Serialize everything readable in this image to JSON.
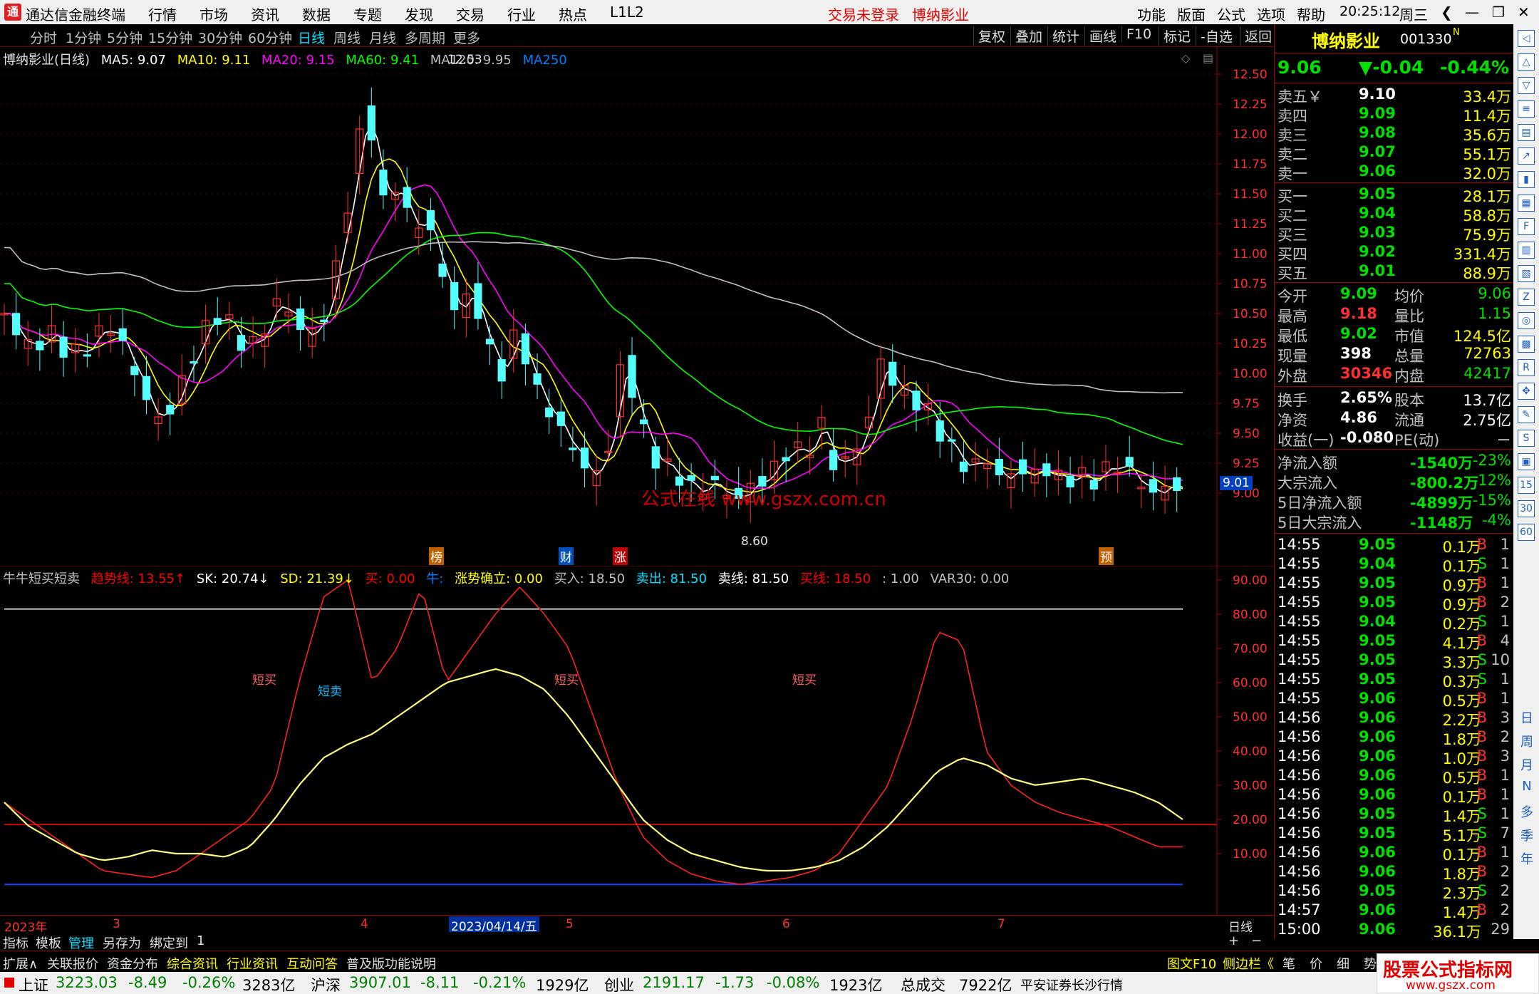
{
  "app": {
    "title": "通达信金融终端",
    "warn1": "交易未登录",
    "stock_title": "博纳影业",
    "l2": "L1L2",
    "menus": [
      "行情",
      "市场",
      "资讯",
      "数据",
      "专题",
      "发现",
      "交易",
      "行业",
      "热点"
    ],
    "right_menus": [
      "功能",
      "版面",
      "公式",
      "选项",
      "帮助"
    ],
    "time": "20:25:12",
    "weekday": "周三"
  },
  "periods": [
    "分时",
    "1分钟",
    "5分钟",
    "15分钟",
    "30分钟",
    "60分钟",
    "日线",
    "周线",
    "月线",
    "多周期",
    "更多"
  ],
  "selected_period": "日线",
  "tools": [
    "复权",
    "叠加",
    "统计",
    "画线",
    "F10",
    "标记",
    "-自选",
    "返回"
  ],
  "main": {
    "name": "博纳影业(日线)",
    "ma": [
      {
        "t": "MA5: 9.07",
        "c": "#ffffff"
      },
      {
        "t": "MA10: 9.11",
        "c": "#ffff00"
      },
      {
        "t": "MA20: 9.15",
        "c": "#ff00ff"
      },
      {
        "t": "MA60: 9.41",
        "c": "#00ff00"
      },
      {
        "t": "MA120: 9.95",
        "c": "#c0c0c0"
      },
      {
        "t": "MA250",
        "c": "#0080ff"
      }
    ],
    "high_label": "12.53",
    "low_label": "8.60",
    "last_label": "9.01",
    "watermark": "公式在线 www.gszx.com.cn",
    "marks": [
      {
        "t": "榜",
        "c": "#ff8000"
      },
      {
        "t": "财",
        "c": "#0080ff"
      },
      {
        "t": "涨",
        "c": "#ff0000"
      },
      {
        "t": "预",
        "c": "#ff8000"
      }
    ],
    "yticks": [
      "12.50",
      "12.25",
      "12.00",
      "11.75",
      "11.50",
      "11.25",
      "11.00",
      "10.75",
      "10.50",
      "10.25",
      "10.00",
      "9.75",
      "9.50",
      "9.25",
      "9.00"
    ]
  },
  "ind": {
    "legend": [
      {
        "t": "牛牛短买短卖",
        "c": "#c0c0c0"
      },
      {
        "t": "趋势线: 13.55↑",
        "c": "#ff0000"
      },
      {
        "t": "SK: 20.74↓",
        "c": "#ffffff"
      },
      {
        "t": "SD: 21.39↓",
        "c": "#ffff00"
      },
      {
        "t": "买: 0.00",
        "c": "#ff0000"
      },
      {
        "t": "牛:",
        "c": "#0080ff"
      },
      {
        "t": "涨势确立: 0.00",
        "c": "#ffff00"
      },
      {
        "t": "买入: 18.50",
        "c": "#c0c0c0"
      },
      {
        "t": "卖出: 81.50",
        "c": "#00e0ff"
      },
      {
        "t": "卖线: 81.50",
        "c": "#ffffff"
      },
      {
        "t": "买线: 18.50",
        "c": "#ff0000"
      },
      {
        "t": ": 1.00",
        "c": "#c0c0c0"
      },
      {
        "t": "VAR30: 0.00",
        "c": "#c0c0c0"
      }
    ],
    "labels": [
      {
        "t": "短买",
        "c": "#ff6060"
      },
      {
        "t": "短卖",
        "c": "#00c0ff"
      },
      {
        "t": "短买",
        "c": "#ff6060"
      },
      {
        "t": "短买",
        "c": "#ff6060"
      }
    ],
    "yticks": [
      "90.00",
      "80.00",
      "70.00",
      "60.00",
      "50.00",
      "40.00",
      "30.00",
      "20.00",
      "10.00"
    ]
  },
  "dates": [
    "2023年",
    "3",
    "4",
    "2023/04/14/五",
    "5",
    "6",
    "7",
    "日线"
  ],
  "tabs": [
    "指标",
    "模板",
    "管理",
    "另存为",
    "绑定到",
    "1"
  ],
  "status_tabs": [
    "扩展∧",
    "关联报价",
    "资金分布",
    "综合资讯",
    "行业资讯",
    "互动问答",
    "普及版功能说明"
  ],
  "status_right": [
    "图文F10",
    "侧边栏《",
    "笔",
    "价",
    "细",
    "势"
  ],
  "quote": {
    "name": "博纳影业",
    "code": "001330",
    "tag": "N",
    "price": "9.06",
    "change": "▼-0.04",
    "pct": "-0.44%",
    "asks": [
      {
        "l": "卖五￥",
        "p": "9.10",
        "v": "33.4万"
      },
      {
        "l": "卖四",
        "p": "9.09",
        "v": "11.4万"
      },
      {
        "l": "卖三",
        "p": "9.08",
        "v": "35.6万"
      },
      {
        "l": "卖二",
        "p": "9.07",
        "v": "55.1万"
      },
      {
        "l": "卖一",
        "p": "9.06",
        "v": "32.0万"
      }
    ],
    "bids": [
      {
        "l": "买一",
        "p": "9.05",
        "v": "28.1万"
      },
      {
        "l": "买二",
        "p": "9.04",
        "v": "58.8万"
      },
      {
        "l": "买三",
        "p": "9.03",
        "v": "75.9万"
      },
      {
        "l": "买四",
        "p": "9.02",
        "v": "331.4万"
      },
      {
        "l": "买五",
        "p": "9.01",
        "v": "88.9万"
      }
    ],
    "stats": [
      [
        "今开",
        "9.09",
        "均价",
        "9.06"
      ],
      [
        "最高",
        "9.18",
        "量比",
        "1.15"
      ],
      [
        "最低",
        "9.02",
        "市值",
        "124.5亿"
      ],
      [
        "现量",
        "398",
        "总量",
        "72763"
      ],
      [
        "外盘",
        "30346",
        "内盘",
        "42417"
      ]
    ],
    "stats2": [
      [
        "换手",
        "2.65%",
        "股本",
        "13.7亿"
      ],
      [
        "净资",
        "4.86",
        "流通",
        "2.75亿"
      ],
      [
        "收益(一)",
        "-0.080",
        "PE(动)",
        "－"
      ]
    ],
    "flows": [
      [
        "净流入额",
        "-1540万",
        "-23%"
      ],
      [
        "大宗流入",
        "-800.2万",
        "-12%"
      ],
      [
        "5日净流入额",
        "-4899万",
        "-15%"
      ],
      [
        "5日大宗流入",
        "-1148万",
        "-4%"
      ]
    ],
    "ticks": [
      [
        "14:55",
        "9.05",
        "0.1万",
        "B",
        "1"
      ],
      [
        "14:55",
        "9.04",
        "0.1万",
        "S",
        "1"
      ],
      [
        "14:55",
        "9.05",
        "0.9万",
        "B",
        "1"
      ],
      [
        "14:55",
        "9.05",
        "0.9万",
        "B",
        "2"
      ],
      [
        "14:55",
        "9.04",
        "0.2万",
        "S",
        "1"
      ],
      [
        "14:55",
        "9.05",
        "4.1万",
        "B",
        "4"
      ],
      [
        "14:55",
        "9.05",
        "3.3万",
        "S",
        "10"
      ],
      [
        "14:55",
        "9.05",
        "0.3万",
        "S",
        "1"
      ],
      [
        "14:55",
        "9.06",
        "0.5万",
        "B",
        "1"
      ],
      [
        "14:56",
        "9.06",
        "2.2万",
        "B",
        "3"
      ],
      [
        "14:56",
        "9.06",
        "1.8万",
        "B",
        "2"
      ],
      [
        "14:56",
        "9.06",
        "1.0万",
        "B",
        "3"
      ],
      [
        "14:56",
        "9.06",
        "0.5万",
        "B",
        "1"
      ],
      [
        "14:56",
        "9.06",
        "0.1万",
        "B",
        "1"
      ],
      [
        "14:56",
        "9.05",
        "1.4万",
        "S",
        "1"
      ],
      [
        "14:56",
        "9.05",
        "5.1万",
        "S",
        "7"
      ],
      [
        "14:56",
        "9.06",
        "0.1万",
        "B",
        "1"
      ],
      [
        "14:56",
        "9.06",
        "1.8万",
        "B",
        "2"
      ],
      [
        "14:56",
        "9.05",
        "2.3万",
        "S",
        "2"
      ],
      [
        "14:57",
        "9.06",
        "1.4万",
        "B",
        "2"
      ],
      [
        "15:00",
        "9.06",
        "36.1万",
        "",
        "29"
      ]
    ]
  },
  "sidebar": [
    "日",
    "周",
    "月",
    "N",
    "多",
    "季",
    "年"
  ],
  "indexbar": {
    "sh_name": "上证",
    "sh_val": "3223.03",
    "sh_chg": "-8.49",
    "sh_pct": "-0.26%",
    "sh_amt": "3283亿",
    "sz_name": "沪深",
    "sz_val": "3907.01",
    "sz_chg": "-8.11",
    "sz_pct": "-0.21%",
    "sz_amt": "1929亿",
    "cy_name": "创业",
    "cy_val": "2191.17",
    "cy_chg": "-1.73",
    "cy_pct": "-0.08%",
    "cy_amt": "1923亿",
    "total_name": "总成交",
    "total_val": "7922亿",
    "broker": "平安证券长沙行情",
    "brand": "股票公式指标网",
    "brand_url": "www.gszx.com"
  }
}
